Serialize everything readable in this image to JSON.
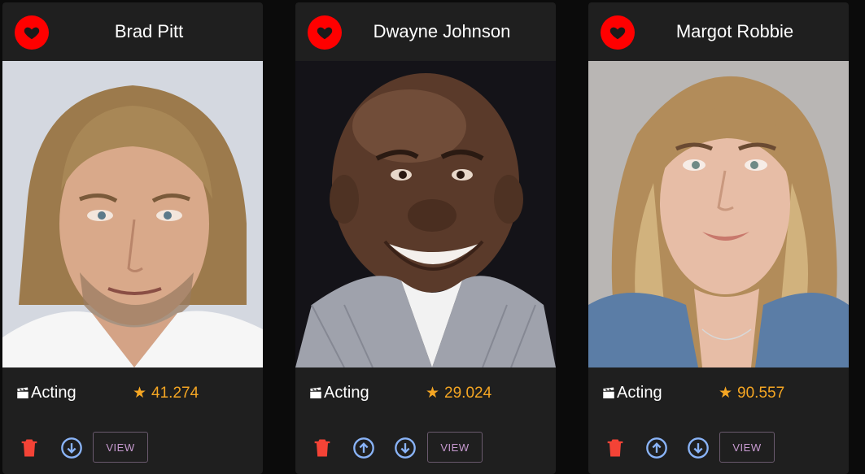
{
  "colors": {
    "card_bg": "#1f1f1f",
    "favorite": "#ff0000",
    "rating": "#f5a623",
    "delete": "#f44336",
    "arrow": "#8ab4f8",
    "view_text": "#c79ad0"
  },
  "cards": [
    {
      "name": "Brad Pitt",
      "department": "Acting",
      "popularity": "41.274",
      "view_label": "VIEW"
    },
    {
      "name": "Dwayne Johnson",
      "department": "Acting",
      "popularity": "29.024",
      "view_label": "VIEW"
    },
    {
      "name": "Margot Robbie",
      "department": "Acting",
      "popularity": "90.557",
      "view_label": "VIEW"
    }
  ]
}
